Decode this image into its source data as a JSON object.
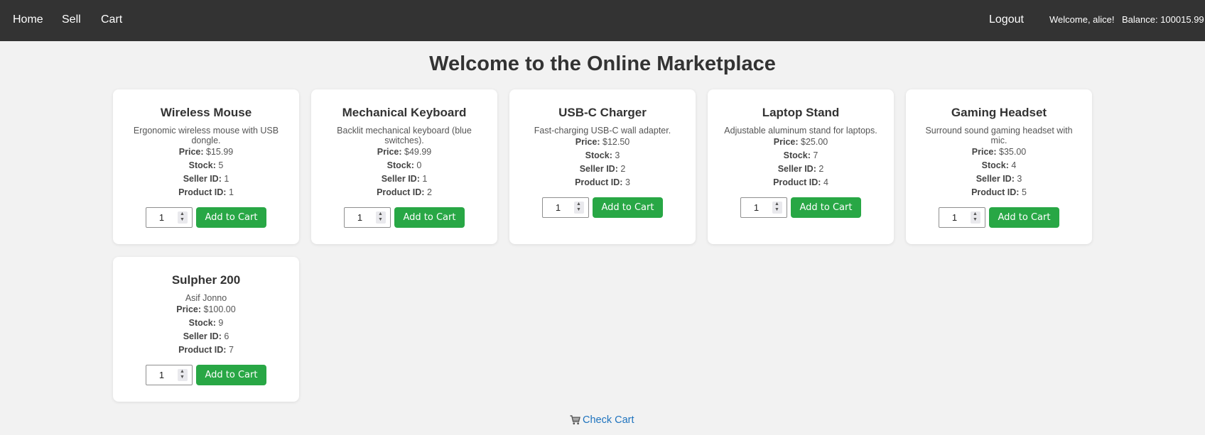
{
  "nav": {
    "home": "Home",
    "sell": "Sell",
    "cart": "Cart",
    "logout": "Logout",
    "welcome": "Welcome, alice!",
    "balance": "Balance: 100015.99"
  },
  "page_title": "Welcome to the Online Marketplace",
  "labels": {
    "price": "Price:",
    "stock": "Stock:",
    "seller_id": "Seller ID:",
    "product_id": "Product ID:",
    "add_to_cart": "Add to Cart"
  },
  "products": [
    {
      "name": "Wireless Mouse",
      "description": "Ergonomic wireless mouse with USB dongle.",
      "price": "$15.99",
      "stock": "5",
      "seller_id": "1",
      "product_id": "1",
      "quantity": "1"
    },
    {
      "name": "Mechanical Keyboard",
      "description": "Backlit mechanical keyboard (blue switches).",
      "price": "$49.99",
      "stock": "0",
      "seller_id": "1",
      "product_id": "2",
      "quantity": "1"
    },
    {
      "name": "USB-C Charger",
      "description": "Fast-charging USB-C wall adapter.",
      "price": "$12.50",
      "stock": "3",
      "seller_id": "2",
      "product_id": "3",
      "quantity": "1"
    },
    {
      "name": "Laptop Stand",
      "description": "Adjustable aluminum stand for laptops.",
      "price": "$25.00",
      "stock": "7",
      "seller_id": "2",
      "product_id": "4",
      "quantity": "1"
    },
    {
      "name": "Gaming Headset",
      "description": "Surround sound gaming headset with mic.",
      "price": "$35.00",
      "stock": "4",
      "seller_id": "3",
      "product_id": "5",
      "quantity": "1"
    },
    {
      "name": "Sulpher 200",
      "description": "Asif Jonno",
      "price": "$100.00",
      "stock": "9",
      "seller_id": "6",
      "product_id": "7",
      "quantity": "1"
    }
  ],
  "check_cart": "Check Cart",
  "colors": {
    "navbar": "#333333",
    "accent_green": "#28a745",
    "link_blue": "#1e73be",
    "background": "#f2f2f2"
  }
}
